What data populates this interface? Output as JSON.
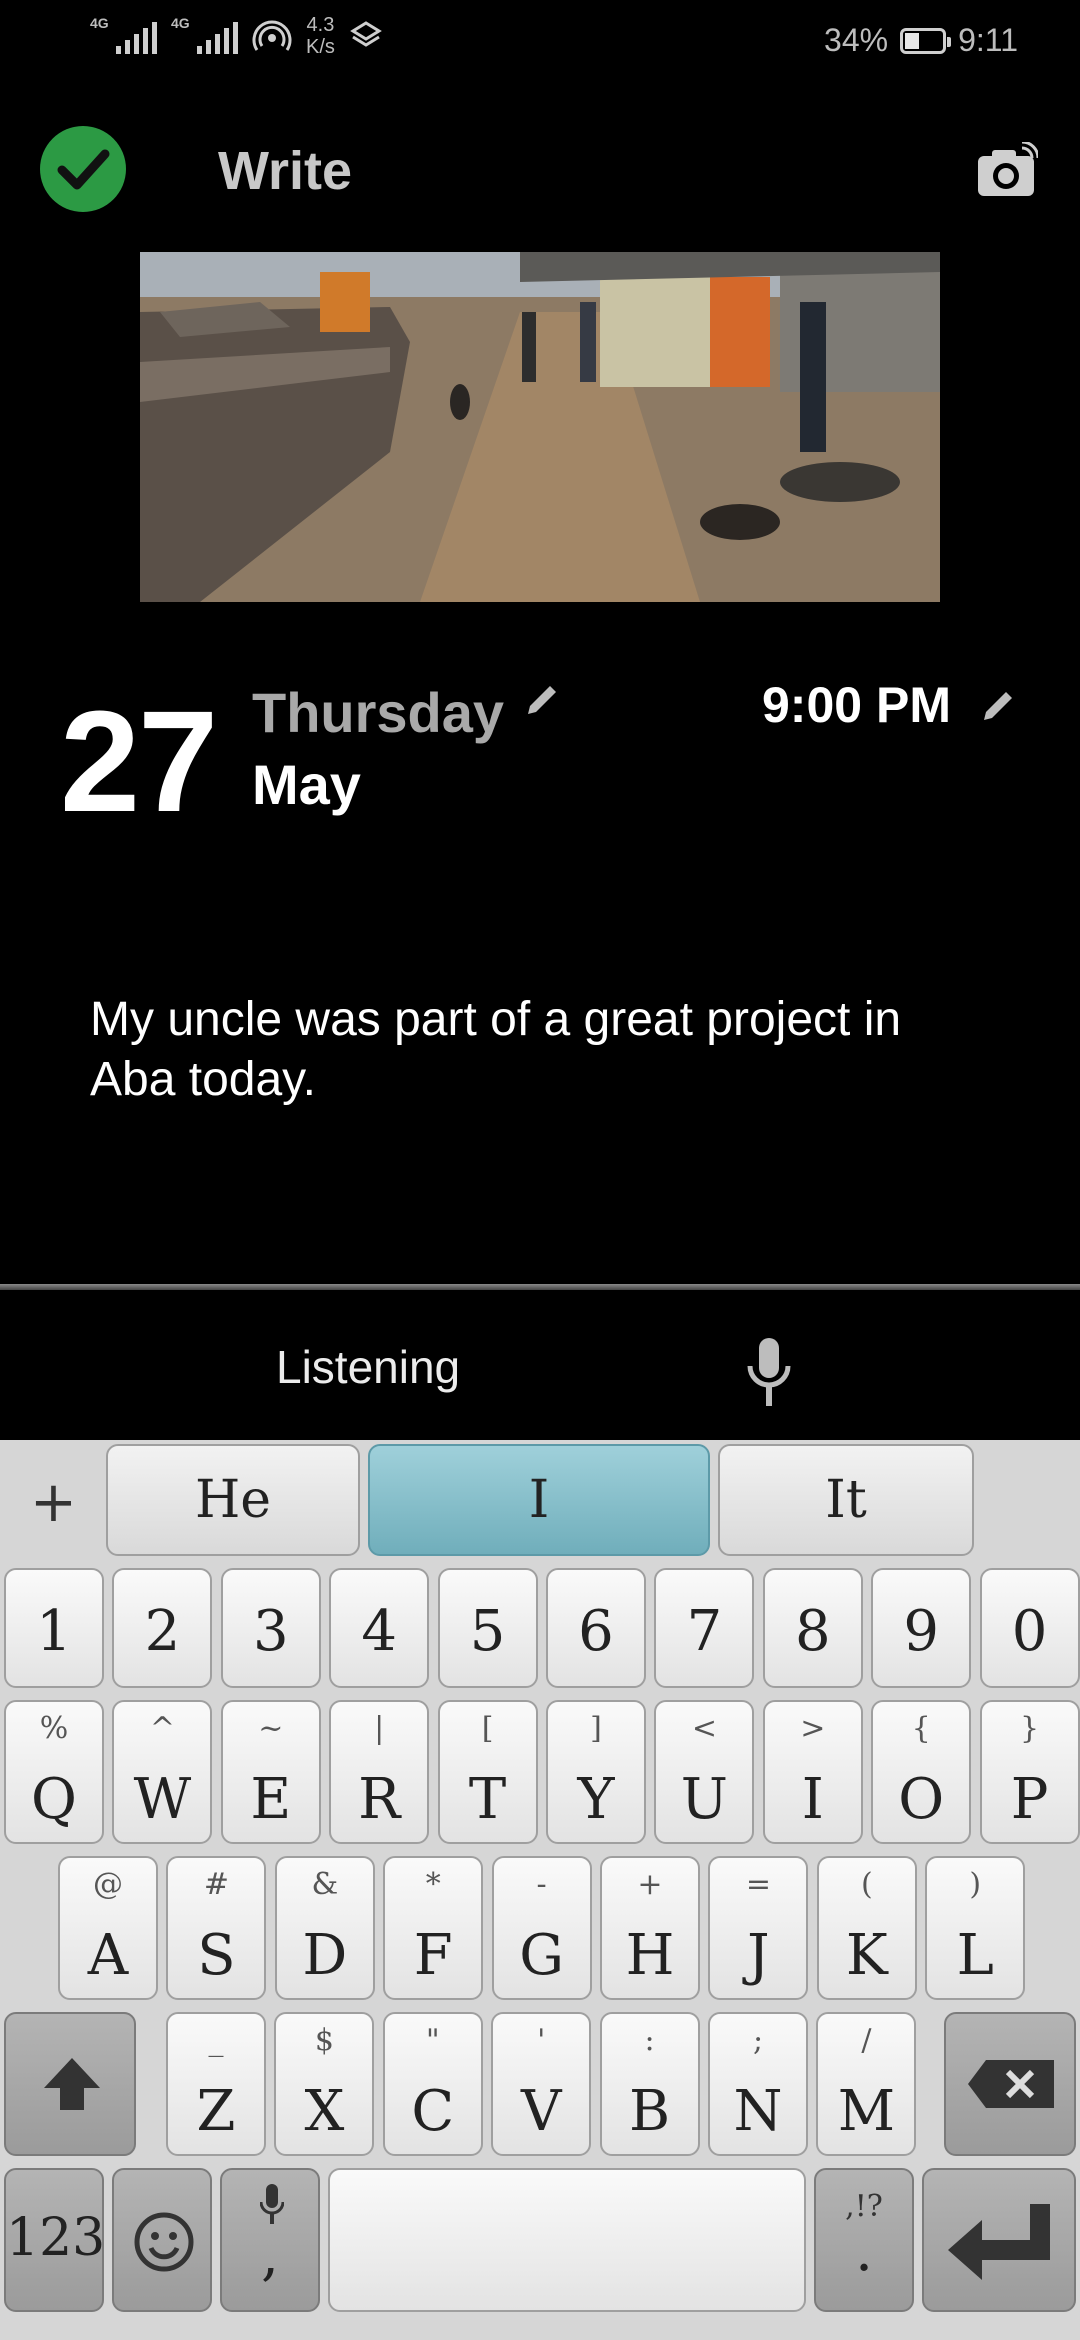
{
  "status_bar": {
    "network_1": "4G",
    "network_2": "4G",
    "speed_value": "4.3",
    "speed_unit": "K/s",
    "battery_percent": "34%",
    "battery_level": 0.34,
    "time": "9:11"
  },
  "header": {
    "title": "Write",
    "save_icon": "check-icon",
    "camera_icon": "camera-icon"
  },
  "date": {
    "day": "27",
    "weekday": "Thursday",
    "month": "May",
    "time": "9:00 PM"
  },
  "entry": {
    "text": "My uncle was part of a great project in Aba today."
  },
  "voice": {
    "status": "Listening"
  },
  "keyboard": {
    "suggestions": [
      "He",
      "I",
      "It"
    ],
    "selected_suggestion": "I",
    "number_row": [
      "1",
      "2",
      "3",
      "4",
      "5",
      "6",
      "7",
      "8",
      "9",
      "0"
    ],
    "row1": [
      {
        "main": "Q",
        "sub": "%"
      },
      {
        "main": "W",
        "sub": "^"
      },
      {
        "main": "E",
        "sub": "~"
      },
      {
        "main": "R",
        "sub": "|"
      },
      {
        "main": "T",
        "sub": "["
      },
      {
        "main": "Y",
        "sub": "]"
      },
      {
        "main": "U",
        "sub": "<"
      },
      {
        "main": "I",
        "sub": ">"
      },
      {
        "main": "O",
        "sub": "{"
      },
      {
        "main": "P",
        "sub": "}"
      }
    ],
    "row2": [
      {
        "main": "A",
        "sub": "@"
      },
      {
        "main": "S",
        "sub": "#"
      },
      {
        "main": "D",
        "sub": "&"
      },
      {
        "main": "F",
        "sub": "*"
      },
      {
        "main": "G",
        "sub": "-"
      },
      {
        "main": "H",
        "sub": "+"
      },
      {
        "main": "J",
        "sub": "="
      },
      {
        "main": "K",
        "sub": "("
      },
      {
        "main": "L",
        "sub": ")"
      }
    ],
    "row3": [
      {
        "main": "Z",
        "sub": "_"
      },
      {
        "main": "X",
        "sub": "$"
      },
      {
        "main": "C",
        "sub": "\""
      },
      {
        "main": "V",
        "sub": "'"
      },
      {
        "main": "B",
        "sub": ":"
      },
      {
        "main": "N",
        "sub": ";"
      },
      {
        "main": "M",
        "sub": "/"
      }
    ],
    "numbers_label": "123",
    "comma": ",",
    "period_main": ".",
    "period_sub": ",!?"
  }
}
